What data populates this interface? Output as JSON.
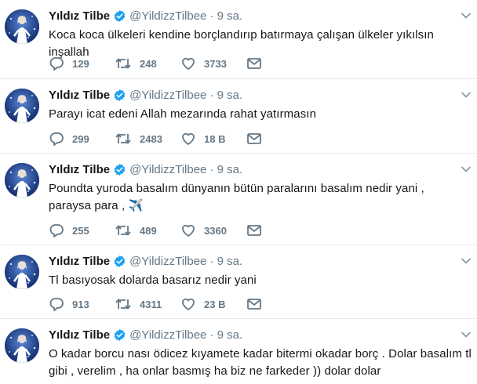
{
  "colors": {
    "verified": "#1da1f2",
    "icon_gray": "#657786",
    "border": "#e6ecf0"
  },
  "icons": {
    "reply": "reply-icon",
    "retweet": "retweet-icon",
    "like": "like-icon",
    "message": "message-icon",
    "verified": "verified-badge-icon",
    "caret": "chevron-down-icon"
  },
  "tweets": [
    {
      "name": "Yıldız Tilbe",
      "handle": "@YildizzTilbee",
      "time": "· 9 sa.",
      "text": "Koca koca ülkeleri kendine borçlandırıp batırmaya çalışan ülkeler  yıkılsın inşallah",
      "replies": "129",
      "retweets": "248",
      "likes": "3733"
    },
    {
      "name": "Yıldız Tilbe",
      "handle": "@YildizzTilbee",
      "time": "· 9 sa.",
      "text": "Parayı icat edeni Allah mezarında rahat yatırmasın",
      "replies": "299",
      "retweets": "2483",
      "likes": "18 B"
    },
    {
      "name": "Yıldız Tilbe",
      "handle": "@YildizzTilbee",
      "time": "· 9 sa.",
      "text": "Poundta yuroda basalım dünyanın bütün paralarını basalım nedir yani , paraysa para ,",
      "emoji": "✈️",
      "replies": "255",
      "retweets": "489",
      "likes": "3360"
    },
    {
      "name": "Yıldız Tilbe",
      "handle": "@YildizzTilbee",
      "time": "· 9 sa.",
      "text": "Tl basıyosak dolarda basarız nedir yani",
      "replies": "913",
      "retweets": "4311",
      "likes": "23 B"
    },
    {
      "name": "Yıldız Tilbe",
      "handle": "@YildizzTilbee",
      "time": "· 9 sa.",
      "text": "O kadar borcu nası ödicez kıyamete kadar bitermi okadar borç . Dolar basalım tl gibi , verelim , ha onlar basmış ha biz ne farkeder )) dolar dolar"
    }
  ]
}
